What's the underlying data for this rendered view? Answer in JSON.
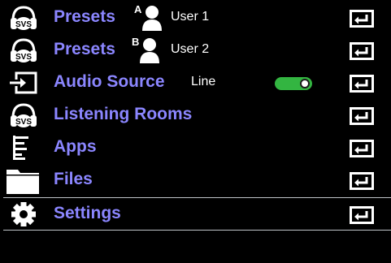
{
  "menu": {
    "items": [
      {
        "id": "presets-a",
        "icon": "svs-headphones-icon",
        "label": "Presets",
        "badge_letter": "A",
        "user_label": "User 1",
        "action_icon": "enter-icon"
      },
      {
        "id": "presets-b",
        "icon": "svs-headphones-icon",
        "label": "Presets",
        "badge_letter": "B",
        "user_label": "User 2",
        "action_icon": "enter-icon"
      },
      {
        "id": "audio-source",
        "icon": "input-source-icon",
        "label": "Audio Source",
        "value": "Line",
        "toggle_on": true,
        "action_icon": "enter-icon"
      },
      {
        "id": "listening-rooms",
        "icon": "svs-headphones-icon",
        "label": "Listening Rooms",
        "action_icon": "enter-icon"
      },
      {
        "id": "apps",
        "icon": "apps-list-icon",
        "label": "Apps",
        "action_icon": "enter-icon"
      },
      {
        "id": "files",
        "icon": "folder-icon",
        "label": "Files",
        "action_icon": "enter-icon"
      },
      {
        "id": "settings",
        "icon": "gear-icon",
        "label": "Settings",
        "selected": true,
        "action_icon": "enter-icon"
      }
    ]
  },
  "svs_logo_text": "SVS",
  "colors": {
    "label": "#8b86ff",
    "text": "#ffffff",
    "toggle_on": "#33b541",
    "selection_border": "#bfc3c7",
    "background": "#000000"
  }
}
